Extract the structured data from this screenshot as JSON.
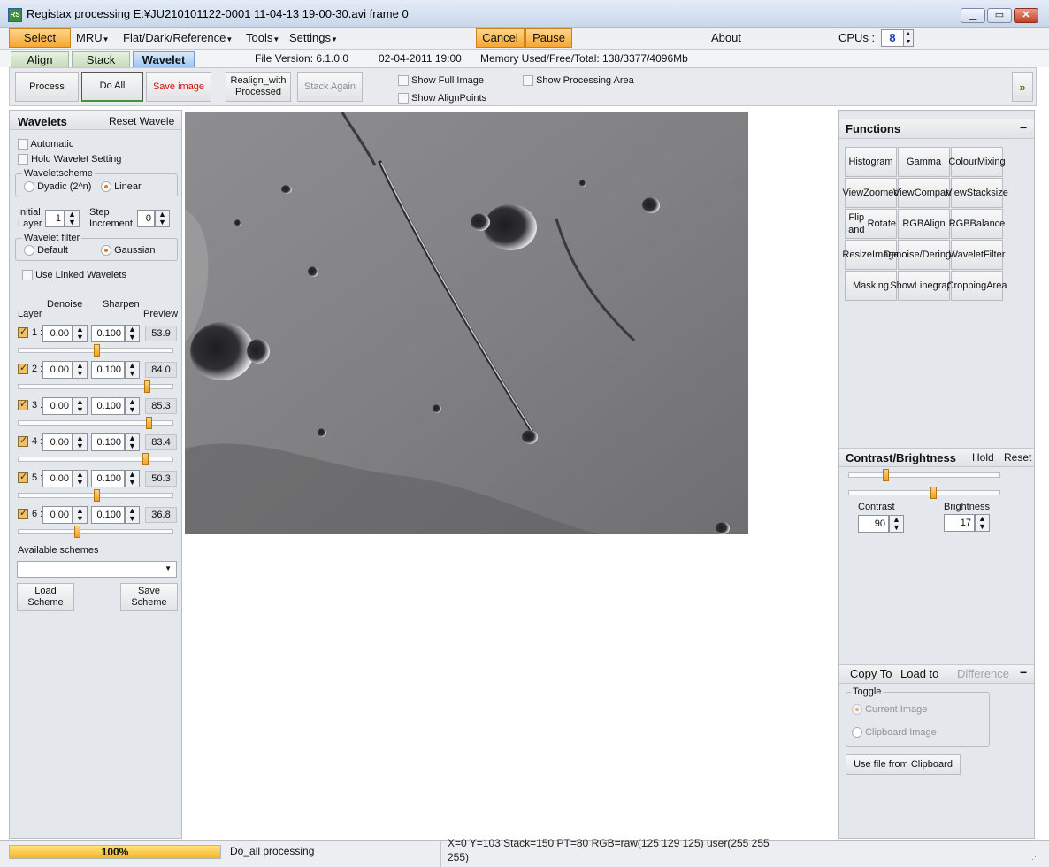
{
  "window": {
    "title": "Registax processing E:¥JU210101122-0001 11-04-13 19-00-30.avi frame 0",
    "app_icon": "RS"
  },
  "menu": {
    "select": "Select",
    "mru": "MRU",
    "flat": "Flat/Dark/Reference",
    "tools": "Tools",
    "settings": "Settings",
    "cancel": "Cancel",
    "pause": "Pause",
    "about": "About",
    "cpus_label": "CPUs :",
    "cpus_value": "8"
  },
  "tabs": {
    "align": "Align",
    "stack": "Stack",
    "wavelet": "Wavelet"
  },
  "info": {
    "file_version": "File Version: 6.1.0.0",
    "date": "02-04-2011 19:00",
    "memory": "Memory Used/Free/Total: 138/3377/4096Mb"
  },
  "toolbar": {
    "process": "Process",
    "do_all": "Do All",
    "save_image": "Save image",
    "realign_1": "Realign_with",
    "realign_2": "Processed",
    "stack_again": "Stack Again",
    "show_full_image": "Show Full Image",
    "show_alignpoints": "Show AlignPoints",
    "show_processing_area": "Show Processing Area",
    "expand": "»"
  },
  "wavelets": {
    "title": "Wavelets",
    "reset": "Reset Wavele",
    "automatic": "Automatic",
    "hold": "Hold Wavelet Setting",
    "scheme_label": "Waveletscheme",
    "dyadic": "Dyadic (2^n)",
    "linear": "Linear",
    "initial_1": "Initial",
    "initial_2": "Layer",
    "initial_value": "1",
    "step_1": "Step",
    "step_2": "Increment",
    "step_value": "0",
    "filter_label": "Wavelet filter",
    "filter_default": "Default",
    "filter_gaussian": "Gaussian",
    "linked": "Use Linked Wavelets",
    "col_layer": "Layer",
    "col_denoise": "Denoise",
    "col_sharpen": "Sharpen",
    "col_preview": "Preview",
    "layers": [
      {
        "num": "1 :",
        "denoise": "0.00",
        "sharpen": "0.100",
        "preview": "53.9",
        "level": 0.5
      },
      {
        "num": "2 :",
        "denoise": "0.00",
        "sharpen": "0.100",
        "preview": "84.0",
        "level": 0.84
      },
      {
        "num": "3 :",
        "denoise": "0.00",
        "sharpen": "0.100",
        "preview": "85.3",
        "level": 0.85
      },
      {
        "num": "4 :",
        "denoise": "0.00",
        "sharpen": "0.100",
        "preview": "83.4",
        "level": 0.83
      },
      {
        "num": "5 :",
        "denoise": "0.00",
        "sharpen": "0.100",
        "preview": "50.3",
        "level": 0.5
      },
      {
        "num": "6 :",
        "denoise": "0.00",
        "sharpen": "0.100",
        "preview": "36.8",
        "level": 0.37
      }
    ],
    "available": "Available schemes",
    "load_1": "Load",
    "load_2": "Scheme",
    "save_1": "Save",
    "save_2": "Scheme"
  },
  "functions": {
    "title": "Functions",
    "collapse": "−",
    "buttons": [
      [
        "Histogram"
      ],
      [
        "Gamma"
      ],
      [
        "Colour",
        "Mixing"
      ],
      [
        "View",
        "Zoomed"
      ],
      [
        "View",
        "Compare"
      ],
      [
        "View",
        "Stacksize"
      ],
      [
        "Flip and",
        "Rotate"
      ],
      [
        "RGB",
        "Align"
      ],
      [
        "RGB",
        "Balance"
      ],
      [
        "Resize",
        "Image"
      ],
      [
        "Denoise/",
        "Deringing"
      ],
      [
        "Wavelet",
        "Filter"
      ],
      [
        "Masking"
      ],
      [
        "Show",
        "Linegraph"
      ],
      [
        "Cropping",
        "Area"
      ]
    ]
  },
  "contrast": {
    "title": "Contrast/Brightness",
    "hold": "Hold",
    "reset": "Reset",
    "contrast_label": "Contrast",
    "contrast_value": "90",
    "brightness_label": "Brightness",
    "brightness_value": "17",
    "contrast_level": 0.23,
    "brightness_level": 0.56
  },
  "copy": {
    "copy_to": "Copy To",
    "load_to": "Load to",
    "difference": "Difference",
    "collapse": "−",
    "toggle": "Toggle",
    "current": "Current Image",
    "clipboard": "Clipboard Image",
    "use_file": "Use file from Clipboard"
  },
  "status": {
    "progress": "100%",
    "progress_level": 1.0,
    "message": "Do_all processing",
    "coords": "X=0 Y=103 Stack=150 PT=80 RGB=raw(125 129 125) user(255 255 255)"
  }
}
